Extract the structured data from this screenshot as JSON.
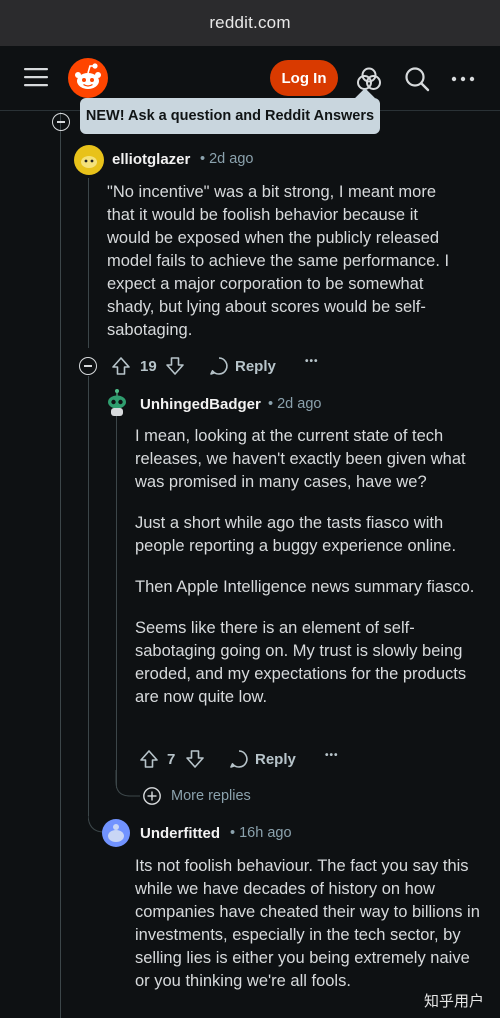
{
  "browser": {
    "url": "reddit.com"
  },
  "header": {
    "login_label": "Log In"
  },
  "tooltip": {
    "text": "NEW! Ask a question and Reddit Answers"
  },
  "comments": [
    {
      "author": "elliotglazer",
      "time": "2d ago",
      "paragraphs": [
        "\"No incentive\" was a bit strong, I meant more that it would be foolish behavior because it would be exposed when the publicly released model fails to achieve the same performance. I expect a major corporation to be somewhat shady, but lying about scores would be self-sabotaging."
      ],
      "votes": "19",
      "reply_label": "Reply"
    },
    {
      "author": "UnhingedBadger",
      "time": "2d ago",
      "paragraphs": [
        "I mean, looking at the current state of tech releases, we haven't exactly been given what was promised in many cases, have we?",
        "Just a short while ago the tasts fiasco with people reporting a buggy experience online.",
        "Then Apple Intelligence news summary fiasco.",
        "Seems like there is an element of self-sabotaging going on. My trust is slowly being eroded, and my expectations for the products are now quite low."
      ],
      "votes": "7",
      "reply_label": "Reply"
    },
    {
      "author": "Underfitted",
      "time": "16h ago",
      "paragraphs": [
        "Its not foolish behaviour. The fact you say this while we have decades of history on how companies have cheated their way to billions in investments, especially in the tech sector, by selling lies is either you being extremely naive or you thinking we're all fools."
      ]
    }
  ],
  "more_replies_label": "More replies",
  "more_dots": "•••",
  "time_separator": "•",
  "watermark": "知乎用户",
  "colors": {
    "accent": "#d93a00",
    "tooltip_bg": "#c9d6de",
    "background": "#0e1113"
  }
}
